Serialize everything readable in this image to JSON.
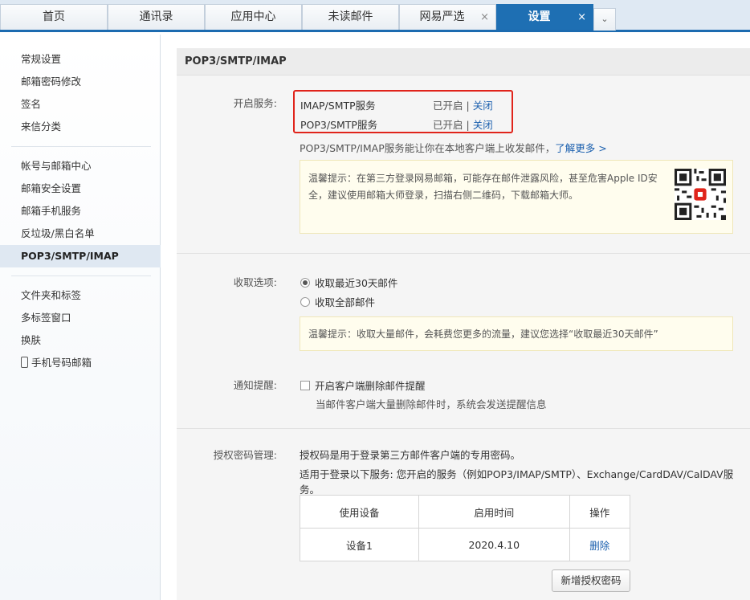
{
  "tabs": [
    {
      "label": "首页",
      "closable": false,
      "active": false
    },
    {
      "label": "通讯录",
      "closable": false,
      "active": false
    },
    {
      "label": "应用中心",
      "closable": false,
      "active": false
    },
    {
      "label": "未读邮件",
      "closable": false,
      "active": false
    },
    {
      "label": "网易严选",
      "closable": true,
      "active": false
    },
    {
      "label": "设置",
      "closable": true,
      "active": true
    }
  ],
  "tab_close_glyph": "×",
  "tab_dropdown_glyph": "⌄",
  "sidebar": {
    "group1": [
      "常规设置",
      "邮箱密码修改",
      "签名",
      "来信分类"
    ],
    "group2": [
      "帐号与邮箱中心",
      "邮箱安全设置",
      "邮箱手机服务",
      "反垃圾/黑白名单",
      "POP3/SMTP/IMAP"
    ],
    "group3": [
      "文件夹和标签",
      "多标签窗口",
      "换肤",
      "手机号码邮箱"
    ],
    "active_item": "POP3/SMTP/IMAP"
  },
  "main": {
    "section_title": "POP3/SMTP/IMAP",
    "enable_service": {
      "label": "开启服务:",
      "services": [
        {
          "name": "IMAP/SMTP服务",
          "status": "已开启",
          "separator": "|",
          "action": "关闭"
        },
        {
          "name": "POP3/SMTP服务",
          "status": "已开启",
          "separator": "|",
          "action": "关闭"
        }
      ],
      "info_text": "POP3/SMTP/IMAP服务能让你在本地客户端上收发邮件，",
      "info_link": "了解更多 >",
      "tip": "温馨提示：在第三方登录网易邮箱，可能存在邮件泄露风险，甚至危害Apple ID安全，建议使用邮箱大师登录，扫描右侧二维码，下载邮箱大师。"
    },
    "receive_options": {
      "label": "收取选项:",
      "options": [
        "收取最近30天邮件",
        "收取全部邮件"
      ],
      "selected_index": 0,
      "tip": "温馨提示：收取大量邮件，会耗费您更多的流量，建议您选择“收取最近30天邮件”"
    },
    "notify": {
      "label": "通知提醒:",
      "checkbox_label": "开启客户端删除邮件提醒",
      "checked": false,
      "note": "当邮件客户端大量删除邮件时，系统会发送提醒信息"
    },
    "auth": {
      "label": "授权密码管理:",
      "line1": "授权码是用于登录第三方邮件客户端的专用密码。",
      "line2": "适用于登录以下服务: 您开启的服务（例如POP3/IMAP/SMTP）、Exchange/CardDAV/CalDAV服务。",
      "table_headers": [
        "使用设备",
        "启用时间",
        "操作"
      ],
      "table_rows": [
        {
          "device": "设备1",
          "date": "2020.4.10",
          "action": "删除"
        }
      ],
      "new_button": "新增授权密码"
    }
  },
  "colors": {
    "accent_blue": "#1e6fb3",
    "link_blue": "#1a5fae",
    "highlight_red": "#e0241b",
    "tip_bg": "#fffdee"
  }
}
